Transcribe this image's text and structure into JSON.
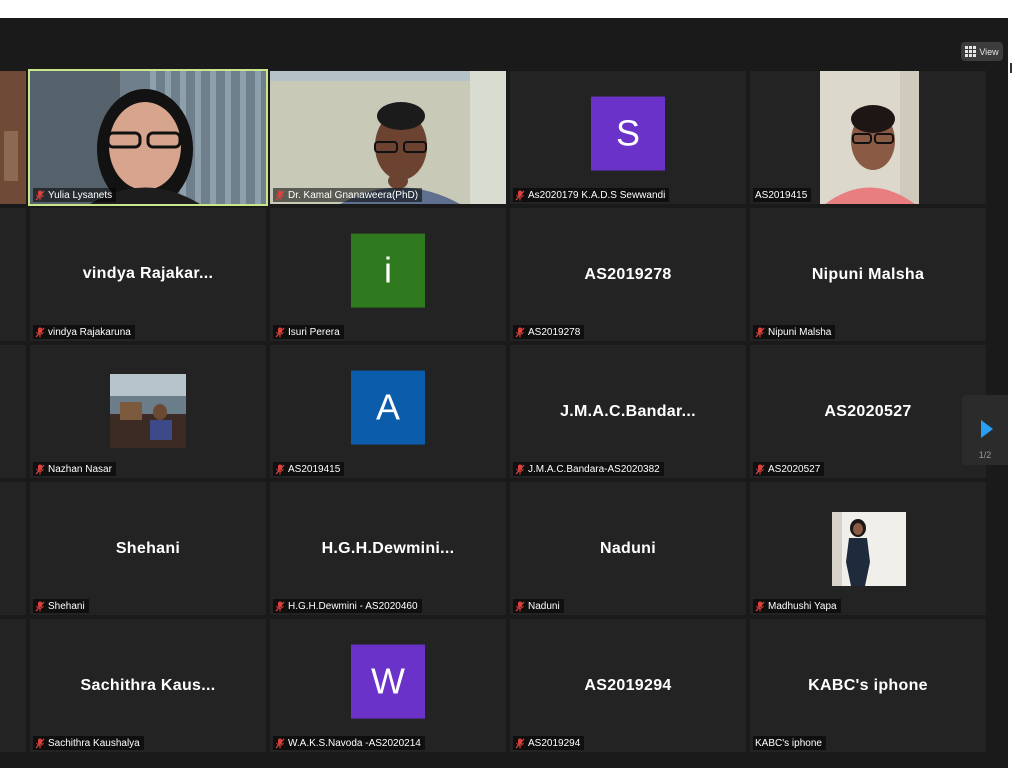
{
  "toolbar": {
    "view_label": "View"
  },
  "pagination": {
    "page_label": "1/2"
  },
  "colors": {
    "background": "#1a1a1a",
    "tile": "#232323",
    "active_speaker_border": "#c9e68a",
    "mic_muted": "#e0413b",
    "next_arrow": "#2a9df4"
  },
  "participants": [
    {
      "label": "Yulia Lysanets",
      "muted": true,
      "video": true,
      "active": true
    },
    {
      "label": "Dr. Kamal Gnanaweera(PhD)",
      "muted": true,
      "video": true
    },
    {
      "label": "As2020179 K.A.D.S Sewwandi",
      "muted": true,
      "avatar_letter": "S",
      "avatar_color": "#6a32c9"
    },
    {
      "label": "AS2019415",
      "muted": false,
      "video": true
    },
    {
      "label": "vindya Rajakaruna",
      "display_name": "vindya  Rajakar...",
      "muted": true
    },
    {
      "label": "Isuri Perera",
      "muted": true,
      "avatar_letter": "i",
      "avatar_color": "#2f7a1f"
    },
    {
      "label": "AS2019278",
      "display_name": "AS2019278",
      "muted": true
    },
    {
      "label": "Nipuni Malsha",
      "display_name": "Nipuni Malsha",
      "muted": true
    },
    {
      "label": "Nazhan Nasar",
      "muted": true,
      "video": true
    },
    {
      "label": "AS2019415",
      "muted": true,
      "avatar_letter": "A",
      "avatar_color": "#0b5cab"
    },
    {
      "label": "J.M.A.C.Bandara-AS2020382",
      "display_name": "J.M.A.C.Bandar...",
      "muted": true
    },
    {
      "label": "AS2020527",
      "display_name": "AS2020527",
      "muted": true
    },
    {
      "label": "Shehani",
      "display_name": "Shehani",
      "muted": true
    },
    {
      "label": "H.G.H.Dewmini - AS2020460",
      "display_name": "H.G.H.Dewmini...",
      "muted": true
    },
    {
      "label": "Naduni",
      "display_name": "Naduni",
      "muted": true
    },
    {
      "label": "Madhushi Yapa",
      "muted": true,
      "video": true
    },
    {
      "label": "Sachithra Kaushalya",
      "display_name": "Sachithra  Kaus...",
      "muted": true
    },
    {
      "label": "W.A.K.S.Navoda -AS2020214",
      "muted": true,
      "avatar_letter": "W",
      "avatar_color": "#6a32c9"
    },
    {
      "label": "AS2019294",
      "display_name": "AS2019294",
      "muted": true
    },
    {
      "label": "KABC's iphone",
      "display_name": "KABC's iphone",
      "muted": false
    }
  ]
}
